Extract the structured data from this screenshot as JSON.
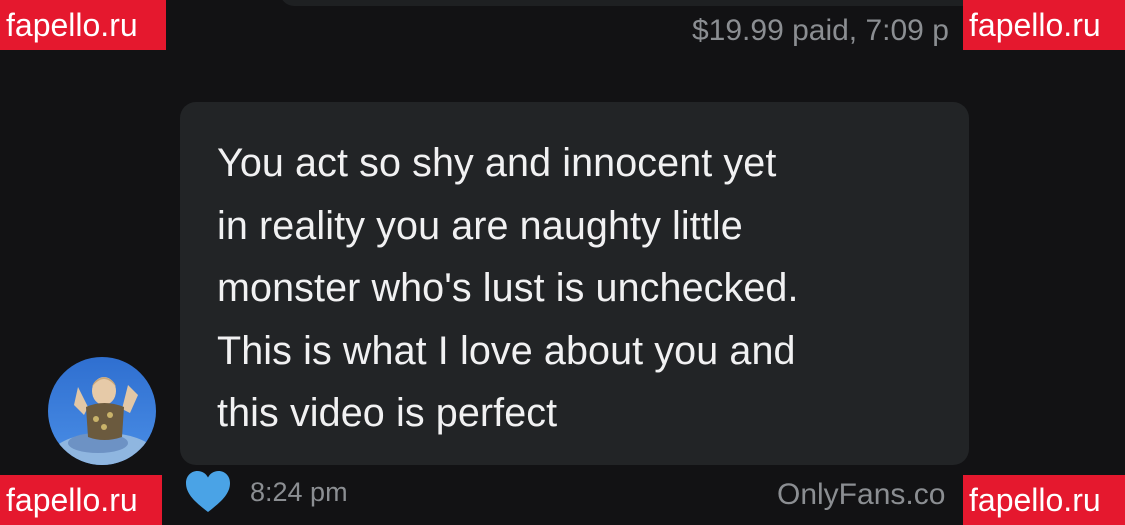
{
  "previous_message": {
    "meta": "$19.99 paid, 7:09 p"
  },
  "message": {
    "text": "You act so shy and innocent yet\nin reality you are naughty little\nmonster who's lust is unchecked.\nThis is what I love about you and\nthis video is perfect",
    "time": "8:24 pm",
    "liked": true
  },
  "footer": {
    "brand": "OnlyFans.co"
  },
  "watermark": {
    "text": "fapello.ru"
  },
  "icons": {
    "like": "heart-icon",
    "avatar": "avatar-image"
  },
  "colors": {
    "background": "#121214",
    "bubble": "#222426",
    "heart": "#4aa3e6",
    "watermark": "#e5182e",
    "muted_text": "#8b8e92"
  }
}
